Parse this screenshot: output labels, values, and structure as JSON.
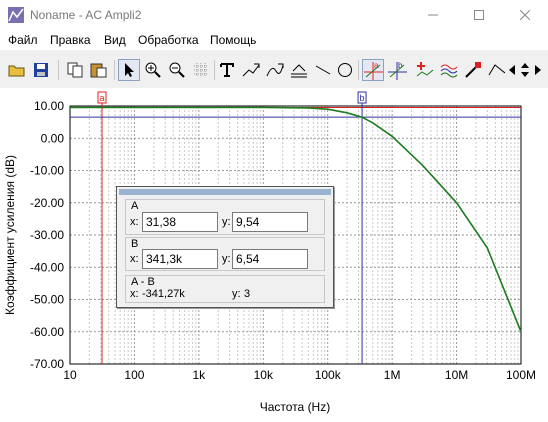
{
  "window": {
    "title": "Noname - AC Ampli2"
  },
  "menu": [
    "Файл",
    "Правка",
    "Вид",
    "Обработка",
    "Помощь"
  ],
  "toolbar": {
    "icons": [
      "open-folder-icon",
      "save-icon",
      "copy-icon",
      "paste-icon",
      "pointer-icon",
      "zoom-in-icon",
      "zoom-out-icon",
      "grid-icon",
      "text-tool-icon",
      "edit-curve-icon",
      "edit-curve2-icon",
      "axis-format-icon",
      "line-tool-icon",
      "circle-tool-icon",
      "cursor-a-icon",
      "cursor-b-icon",
      "add-marker-icon",
      "signal-icon",
      "probe-icon",
      "step-icon",
      "arrow-left-icon",
      "arrow-up-down-icon",
      "arrow-right-icon"
    ]
  },
  "chart_data": {
    "type": "line",
    "xscale": "log",
    "xlim": [
      10,
      100000000
    ],
    "ylim": [
      -70,
      10
    ],
    "xlabel": "Частота (Hz)",
    "ylabel": "Коэффициент усиления (dB)",
    "x_ticks": [
      "10",
      "100",
      "1k",
      "10k",
      "100k",
      "1M",
      "10M",
      "100M"
    ],
    "y_ticks": [
      "10.00",
      "0.00",
      "-10.00",
      "-20.00",
      "-30.00",
      "-40.00",
      "-50.00",
      "-60.00",
      "-70.00"
    ],
    "grid": true,
    "series": [
      {
        "color": "#1e7b1e",
        "x": [
          10,
          100,
          1000,
          10000,
          50000,
          100000,
          200000,
          341300,
          500000,
          1000000,
          3000000,
          10000000,
          30000000,
          100000000
        ],
        "y": [
          9.54,
          9.54,
          9.54,
          9.54,
          9.4,
          9.0,
          7.9,
          6.54,
          4.8,
          0.6,
          -8.5,
          -20.0,
          -34.0,
          -60.0
        ]
      }
    ],
    "cursors": [
      {
        "label": "a",
        "x": 31.38,
        "y": 9.54,
        "vcolor": "#e02020",
        "hcolor": "#e02020"
      },
      {
        "label": "b",
        "x": 341300,
        "y": 6.54,
        "vcolor": "#3030a0",
        "hcolor": "#3030a0"
      }
    ]
  },
  "cursor_panel": {
    "a": {
      "label": "A",
      "x_label": "x:",
      "x_value": "31,38",
      "y_label": "y:",
      "y_value": "9,54"
    },
    "b": {
      "label": "B",
      "x_label": "x:",
      "x_value": "341,3k",
      "y_label": "y:",
      "y_value": "6,54"
    },
    "diff": {
      "label": "A - B",
      "x_label": "x:",
      "x_value": "-341,27k",
      "y_label": "y:",
      "y_value": "3"
    }
  }
}
